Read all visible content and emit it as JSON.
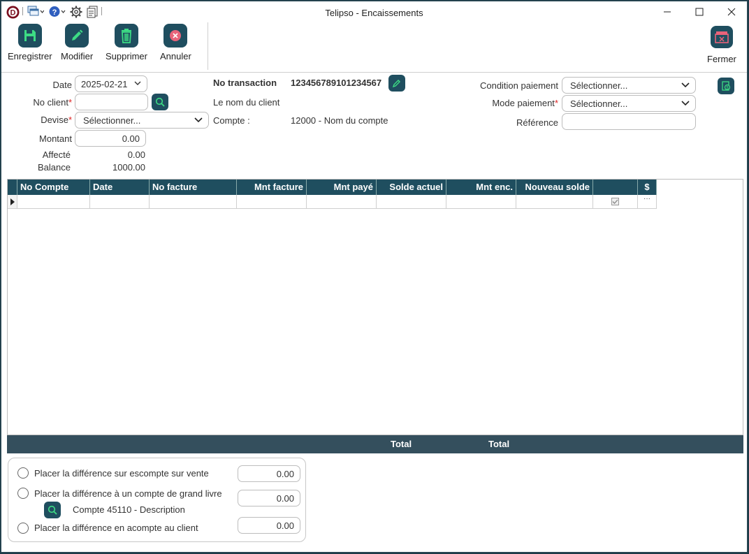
{
  "window": {
    "title": "Telipso - Encaissements"
  },
  "toolbar": {
    "save_label": "Enregistrer",
    "edit_label": "Modifier",
    "delete_label": "Supprimer",
    "cancel_label": "Annuler",
    "close_label": "Fermer"
  },
  "form": {
    "date_label": "Date",
    "date_value": "2025-02-21",
    "client_label": "No client",
    "client_value": "",
    "currency_label": "Devise",
    "currency_placeholder": "Sélectionner...",
    "amount_label": "Montant",
    "amount_value": "0.00",
    "assigned_label": "Affecté",
    "assigned_value": "0.00",
    "balance_label": "Balance",
    "balance_value": "1000.00",
    "transaction_label": "No transaction",
    "transaction_value": "123456789101234567",
    "client_name": "Le nom du client",
    "account_label": "Compte :",
    "account_value": "12000 - Nom du compte",
    "payment_condition_label": "Condition paiement",
    "payment_condition_placeholder": "Sélectionner...",
    "payment_mode_label": "Mode paiement",
    "payment_mode_placeholder": "Sélectionner...",
    "reference_label": "Référence",
    "reference_value": "",
    "required_mark": "*"
  },
  "grid": {
    "columns": [
      "No Compte",
      "Date",
      "No facture",
      "Mnt facture",
      "Mnt payé",
      "Solde actuel",
      "Mnt enc.",
      "Nouveau solde",
      "",
      "$"
    ],
    "row_ellipsis": "···",
    "footer_total_1": "Total",
    "footer_total_2": "Total"
  },
  "options": {
    "opt1_label": "Placer la différence sur escompte sur vente",
    "opt1_value": "0.00",
    "opt2_label": "Placer la différence à un compte de grand livre",
    "opt2_value": "0.00",
    "opt2_account": "Compte 45110 - Description",
    "opt3_label": "Placer la différence en acompte au client",
    "opt3_value": "0.00"
  },
  "colors": {
    "accent": "#1f4e5f",
    "footer": "#344f5d",
    "required": "#dd2222",
    "save_icon": "#3ddc84",
    "cancel_icon": "#e8637a"
  }
}
